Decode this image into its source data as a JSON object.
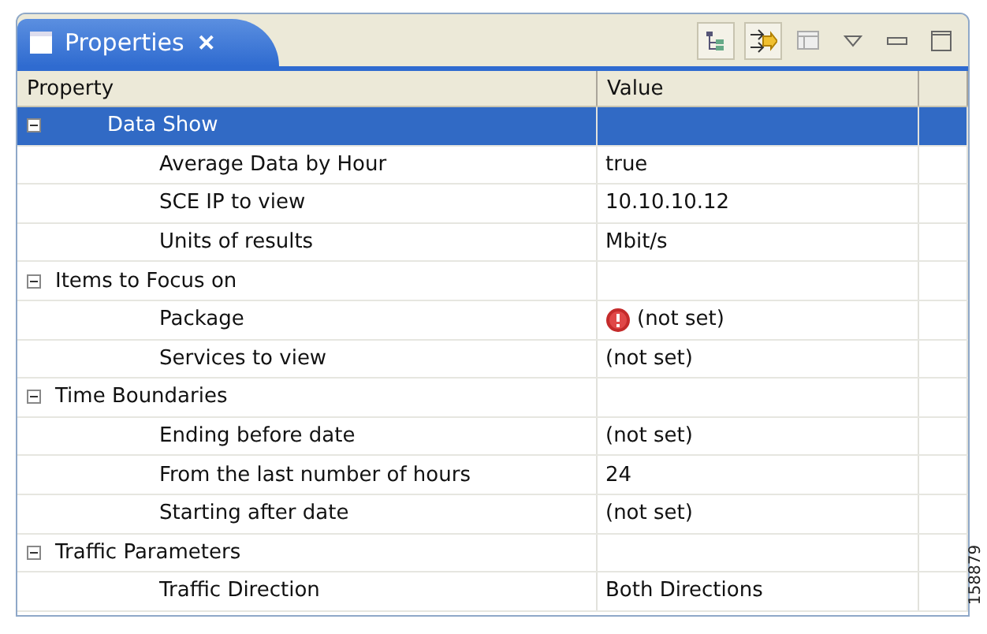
{
  "view_tab": {
    "title": "Properties",
    "close": "✕"
  },
  "table": {
    "columns": [
      "Property",
      "Value"
    ],
    "categories": [
      {
        "name": "Data Show",
        "expanded": true,
        "selected": true,
        "children": [
          {
            "name": "Average Data by Hour",
            "value": "true",
            "error": false
          },
          {
            "name": "SCE IP to view",
            "value": "10.10.10.12",
            "error": false
          },
          {
            "name": "Units of results",
            "value": "Mbit/s",
            "error": false
          }
        ]
      },
      {
        "name": "Items to Focus on",
        "expanded": true,
        "selected": false,
        "children": [
          {
            "name": "Package",
            "value": "(not set)",
            "error": true
          },
          {
            "name": "Services to view",
            "value": "(not set)",
            "error": false
          }
        ]
      },
      {
        "name": "Time Boundaries",
        "expanded": true,
        "selected": false,
        "children": [
          {
            "name": "Ending before date",
            "value": "(not set)",
            "error": false
          },
          {
            "name": "From the last number of hours",
            "value": "24",
            "error": false
          },
          {
            "name": "Starting after date",
            "value": "(not set)",
            "error": false
          }
        ]
      },
      {
        "name": "Traffic Parameters",
        "expanded": true,
        "selected": false,
        "children": [
          {
            "name": "Traffic Direction",
            "value": "Both Directions",
            "error": false
          }
        ]
      }
    ]
  },
  "figure_id": "158879"
}
